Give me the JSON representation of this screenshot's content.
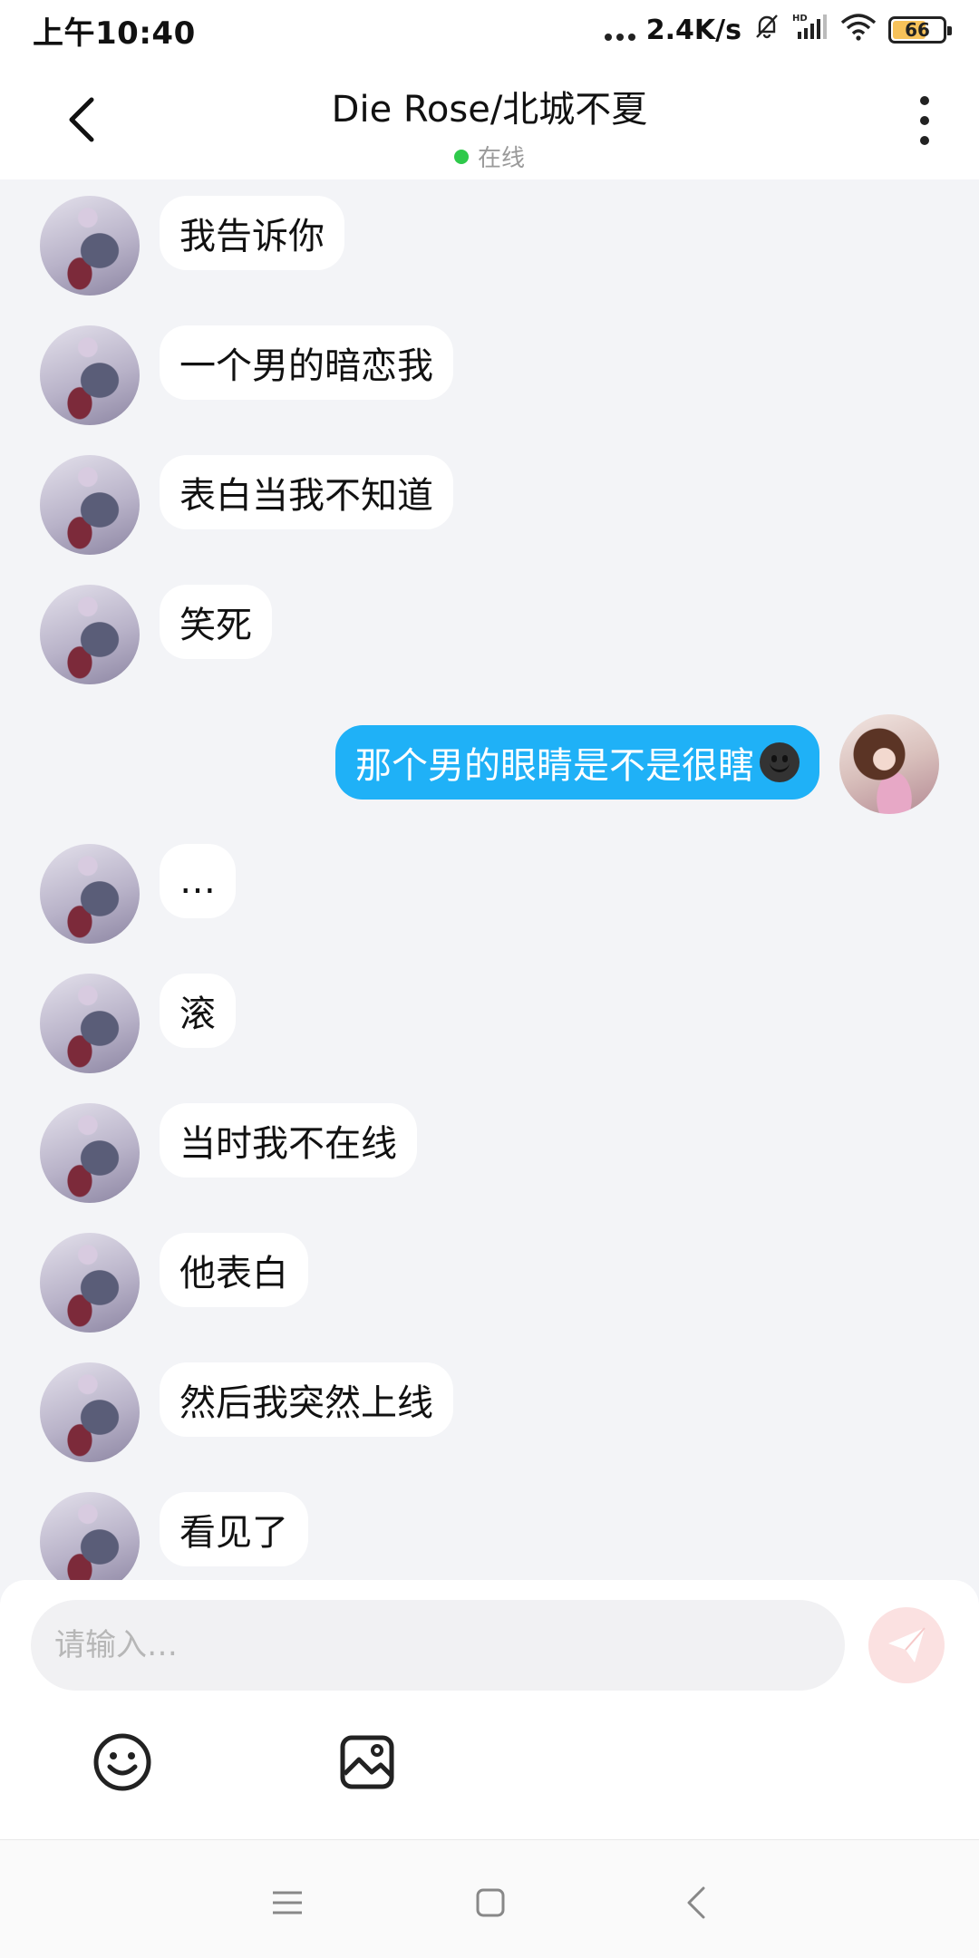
{
  "status_bar": {
    "time": "上午10:40",
    "network_speed": "2.4K/s",
    "battery": "66",
    "icons": [
      "more-dots-icon",
      "mute-bell-icon",
      "hd-signal-icon",
      "wifi-icon",
      "battery-icon"
    ]
  },
  "header": {
    "title": "Die Rose/北城不夏",
    "status": "在线",
    "status_color": "#2ec94a",
    "back_icon": "chevron-left-icon",
    "more_icon": "more-vertical-icon"
  },
  "messages": [
    {
      "from": "other",
      "text": "我告诉你"
    },
    {
      "from": "other",
      "text": "一个男的暗恋我"
    },
    {
      "from": "other",
      "text": "表白当我不知道"
    },
    {
      "from": "other",
      "text": "笑死"
    },
    {
      "from": "self",
      "text": "那个男的眼睛是不是很瞎",
      "emoji": "dark-smiley-emoji"
    },
    {
      "from": "other",
      "text": "…"
    },
    {
      "from": "other",
      "text": "滚"
    },
    {
      "from": "other",
      "text": "当时我不在线"
    },
    {
      "from": "other",
      "text": "他表白"
    },
    {
      "from": "other",
      "text": "然后我突然上线"
    },
    {
      "from": "other",
      "text": "看见了"
    }
  ],
  "composer": {
    "placeholder": "请输入…",
    "value": "",
    "send_icon": "paper-plane-icon",
    "tools": [
      "emoji-icon",
      "image-icon"
    ]
  },
  "nav_bar": {
    "icons": [
      "menu-icon",
      "home-square-icon",
      "back-chevron-icon"
    ]
  },
  "colors": {
    "self_bubble": "#1fb1f7",
    "other_bubble": "#ffffff",
    "chat_background": "#f3f4f7",
    "send_button": "#fbe1e1"
  }
}
